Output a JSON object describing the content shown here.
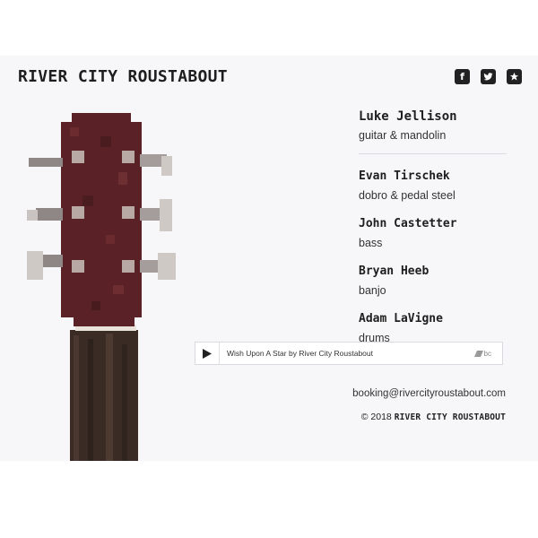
{
  "header": {
    "brand": "RIVER CITY ROUSTABOUT",
    "social": [
      {
        "icon": "facebook-icon",
        "glyph": "f"
      },
      {
        "icon": "twitter-icon",
        "glyph": "t"
      },
      {
        "icon": "star-icon",
        "glyph": "★"
      }
    ]
  },
  "members": [
    {
      "name": "Luke Jellison",
      "role": "guitar & mandolin"
    },
    {
      "name": "Evan Tirschek",
      "role": "dobro & pedal steel"
    },
    {
      "name": "John Castetter",
      "role": "bass"
    },
    {
      "name": "Bryan Heeb",
      "role": "banjo"
    },
    {
      "name": "Adam LaVigne",
      "role": "drums"
    }
  ],
  "player": {
    "track": "Wish Upon A Star by River City Roustabout",
    "logo_text": "bc"
  },
  "footer": {
    "email": "booking@rivercityroustabout.com",
    "copyright_prefix": "© 2018",
    "copyright_name": "RIVER CITY ROUSTABOUT"
  },
  "colors": {
    "page": "#f7f6f8",
    "headstock": "#5a2226",
    "neck": "#3a2a24"
  }
}
